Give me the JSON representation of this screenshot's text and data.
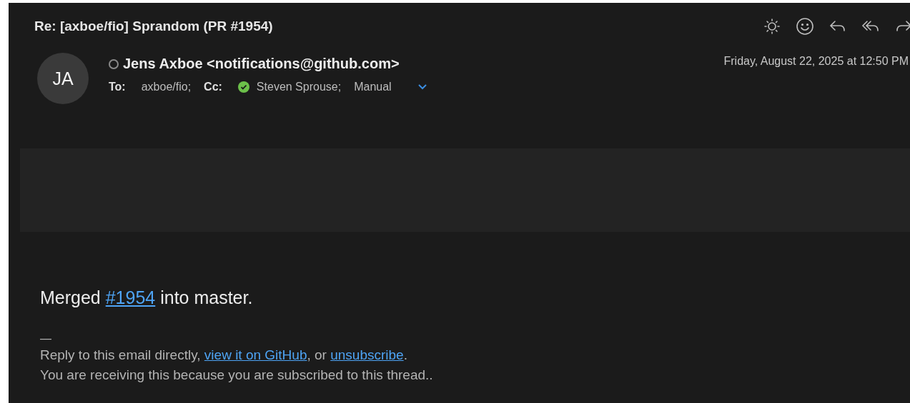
{
  "message": {
    "subject": "Re: [axboe/fio] Sprandom (PR #1954)",
    "sender": {
      "initials": "JA",
      "name": "Jens Axboe <notifications@github.com>",
      "online": false
    },
    "to_label": "To:",
    "to": [
      "axboe/fio;"
    ],
    "cc_label": "Cc:",
    "cc": [
      {
        "name": "Steven Sprouse;",
        "verified": true
      },
      {
        "name": "Manual",
        "verified": false
      }
    ],
    "date": "Friday, August 22, 2025 at 12:50 PM"
  },
  "body": {
    "lines": [
      [
        {
          "kind": "text",
          "text": "Merged "
        },
        {
          "kind": "link",
          "text": "#1954"
        },
        {
          "kind": "text",
          "text": " into master."
        }
      ]
    ],
    "separator": "—",
    "footer": [
      [
        {
          "kind": "text",
          "text": "Reply to this email directly, "
        },
        {
          "kind": "link",
          "text": "view it on GitHub"
        },
        {
          "kind": "text",
          "text": ", or "
        },
        {
          "kind": "link",
          "text": "unsubscribe"
        },
        {
          "kind": "text",
          "text": "."
        }
      ],
      [
        {
          "kind": "text",
          "text": "You are receiving this because you are subscribed to this thread.."
        }
      ]
    ]
  }
}
